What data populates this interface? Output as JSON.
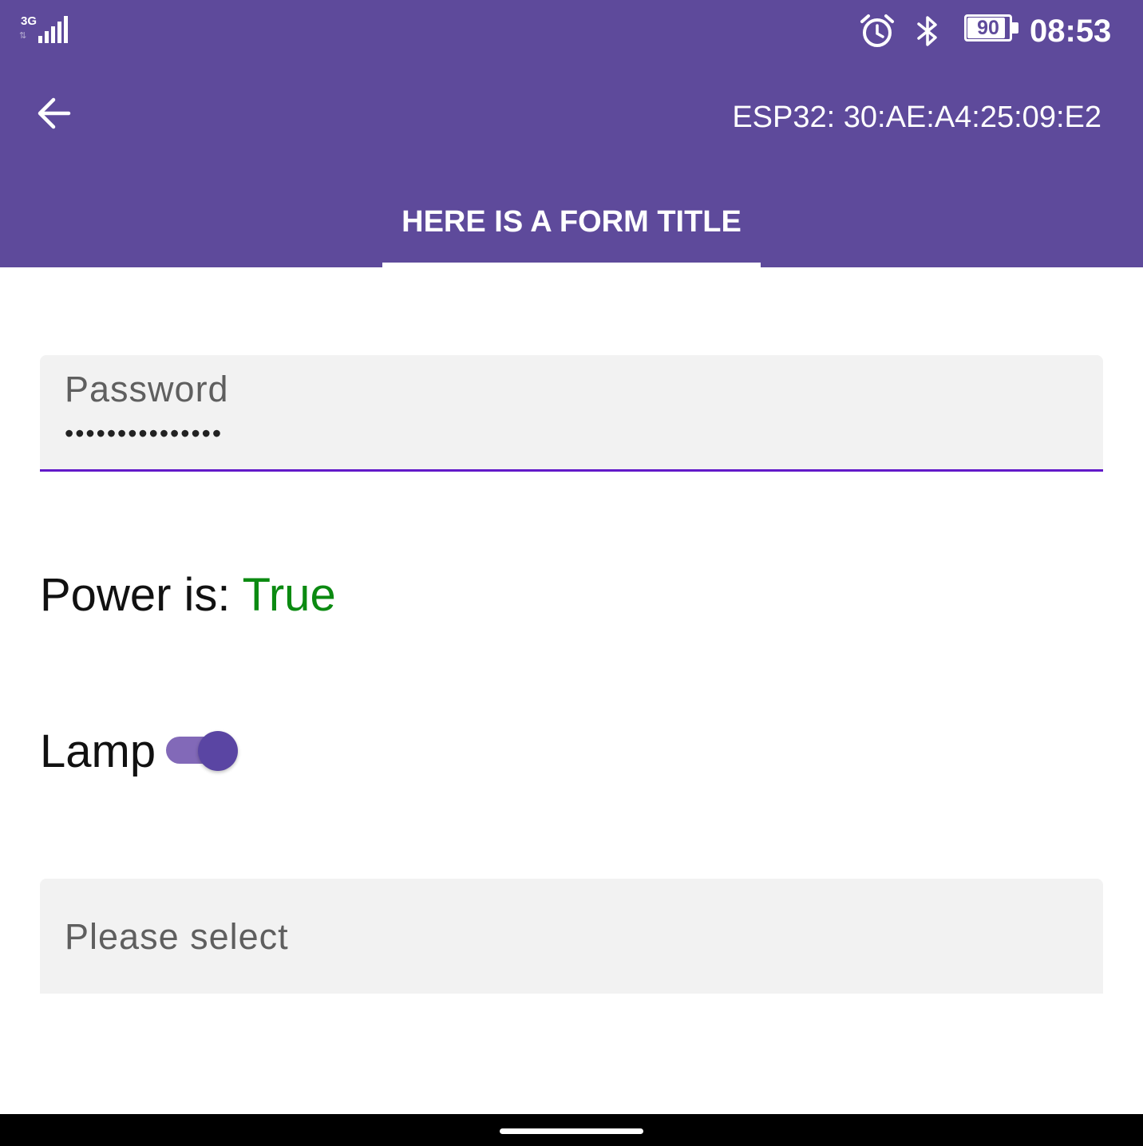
{
  "status_bar": {
    "network_type": "3G",
    "network_arrows": "⇅",
    "battery_level": "90",
    "battery_percent": 90,
    "time": "08:53",
    "icons": [
      "signal-icon",
      "alarm-icon",
      "bluetooth-icon",
      "battery-icon"
    ]
  },
  "toolbar": {
    "back_icon": "arrow-back-icon",
    "title": "ESP32: 30:AE:A4:25:09:E2"
  },
  "tabs": [
    {
      "label": "HERE IS A FORM TITLE",
      "selected": true
    }
  ],
  "form": {
    "password": {
      "label": "Password",
      "value": "•••••••••••••••"
    },
    "power": {
      "label": "Power is: ",
      "value": "True"
    },
    "lamp": {
      "label": "Lamp",
      "checked": true
    },
    "select": {
      "placeholder": "Please select"
    }
  },
  "colors": {
    "primary": "#5e4a9b",
    "focus_underline": "#6219c9",
    "power_true": "#0b8a11",
    "switch_track": "#8269b8",
    "switch_thumb": "#5a45a3",
    "field_background": "#f2f2f2"
  }
}
